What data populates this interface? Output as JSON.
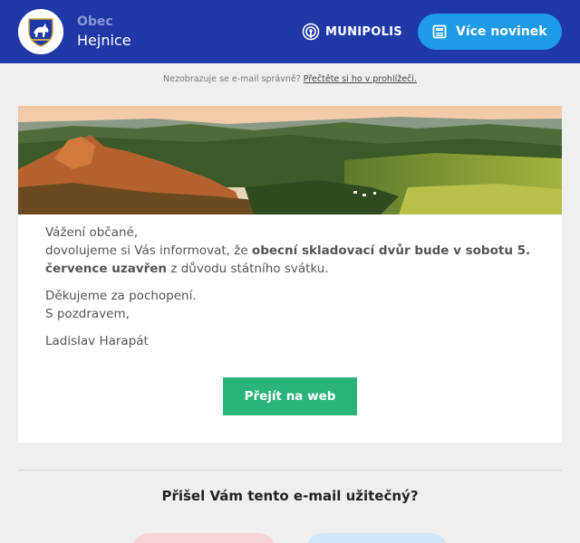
{
  "header": {
    "obec_label": "Obec",
    "obec_name": "Hejnice",
    "brand": "MUNIPOLIS",
    "more_news_label": "Více novinek",
    "bg_color": "#1f38a6",
    "button_color": "#1e9be6"
  },
  "notice": {
    "text": "Nezobrazuje se e-mail správně?",
    "link": "Přečtěte si ho v prohlížeči."
  },
  "message": {
    "greeting": "Vážení občané,",
    "line_start": "dovolujeme si Vás informovat, že ",
    "line_bold": "obecní skladovací dvůr bude v sobotu 5. července uzavřen",
    "line_end": " z důvodu státního svátku.",
    "thanks": "Děkujeme za pochopení.",
    "regards": "S pozdravem,",
    "signature": "Ladislav Harapát"
  },
  "cta": {
    "label": "Přejít na web",
    "color": "#29b47a"
  },
  "feedback": {
    "question": "Přišel Vám tento e-mail užitečný?"
  }
}
